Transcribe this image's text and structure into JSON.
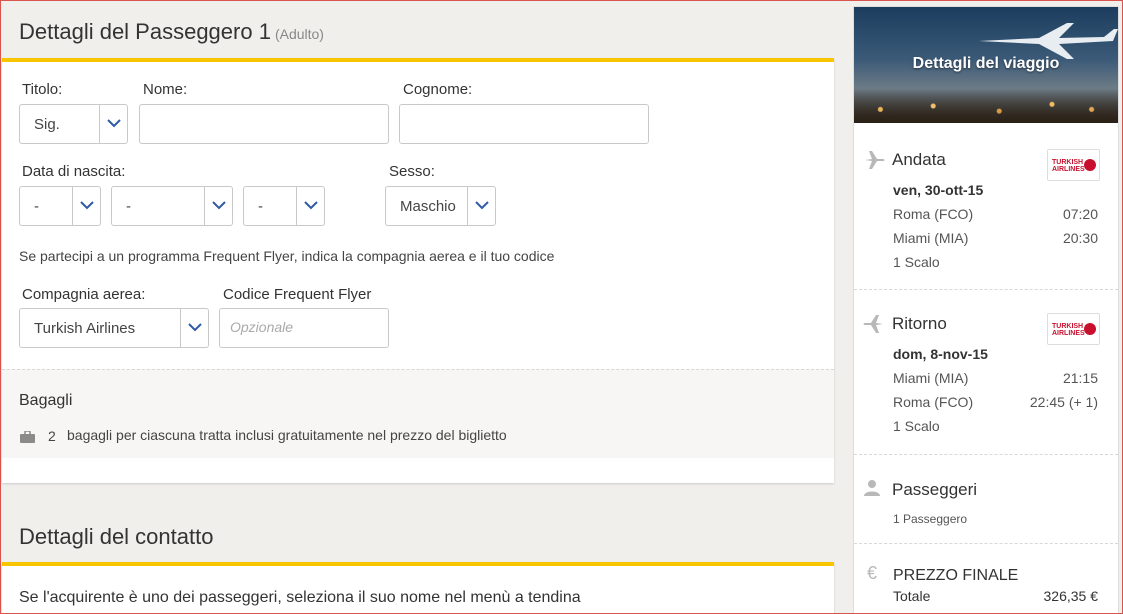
{
  "passenger": {
    "title": "Dettagli del Passeggero 1",
    "subtitle": "(Adulto)",
    "labels": {
      "titolo": "Titolo:",
      "nome": "Nome:",
      "cognome": "Cognome:",
      "data_nascita": "Data di nascita:",
      "sesso": "Sesso:",
      "compagnia": "Compagnia aerea:",
      "codice_ff": "Codice Frequent Flyer"
    },
    "values": {
      "titolo": "Sig.",
      "nome": "",
      "cognome": "",
      "giorno": "-",
      "mese": "-",
      "anno": "-",
      "sesso": "Maschio",
      "compagnia": "Turkish Airlines",
      "codice_ff": ""
    },
    "placeholders": {
      "codice_ff": "Opzionale"
    },
    "frequent_flyer_note": "Se partecipi a un programma Frequent Flyer, indica la compagnia aerea e il tuo codice",
    "baggage": {
      "title": "Bagagli",
      "count": "2",
      "text": "bagagli per ciascuna tratta inclusi gratuitamente nel prezzo del biglietto"
    }
  },
  "contact": {
    "title": "Dettagli del contatto",
    "text": "Se l'acquirente è uno dei passeggeri, seleziona il suo nome nel menù a tendina"
  },
  "sidebar": {
    "banner_title": "Dettagli del viaggio",
    "outbound": {
      "heading": "Andata",
      "date": "ven, 30-ott-15",
      "from": "Roma (FCO)",
      "from_time": "07:20",
      "to": "Miami (MIA)",
      "to_time": "20:30",
      "stops": "1 Scalo",
      "airline_logo": "TURKISH AIRLINES"
    },
    "return": {
      "heading": "Ritorno",
      "date": "dom, 8-nov-15",
      "from": "Miami (MIA)",
      "from_time": "21:15",
      "to": "Roma (FCO)",
      "to_time": "22:45 (+ 1)",
      "stops": "1 Scalo",
      "airline_logo": "TURKISH AIRLINES"
    },
    "passengers": {
      "heading": "Passeggeri",
      "count": "1 Passeggero"
    },
    "price": {
      "heading": "PREZZO FINALE",
      "label": "Totale",
      "value": "326,35 €",
      "currency_symbol": "€"
    }
  },
  "colors": {
    "accent": "#f7c600",
    "chevron": "#2e5aa8",
    "turkish_red": "#c8102e"
  }
}
